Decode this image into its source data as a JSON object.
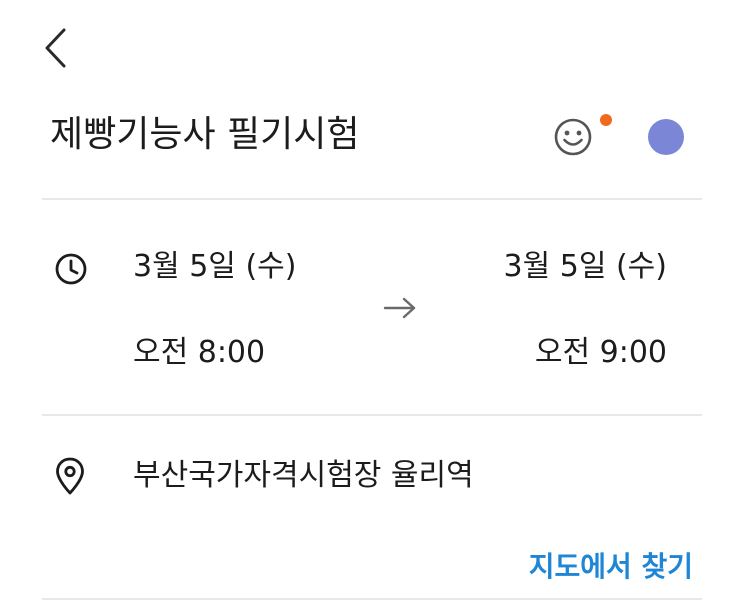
{
  "header": {
    "back_icon": "chevron-left-icon"
  },
  "event": {
    "title": "제빵기능사 필기시험",
    "sticker_icon": "smiley-icon",
    "sticker_badge_color": "#f06a1e",
    "calendar_color": "#7b87d6"
  },
  "time": {
    "icon": "clock-icon",
    "start_date": "3월 5일 (수)",
    "start_time": "오전 8:00",
    "end_date": "3월 5일 (수)",
    "end_time": "오전 9:00",
    "arrow_icon": "arrow-right-icon"
  },
  "location": {
    "icon": "map-pin-icon",
    "name": "부산국가자격시험장 율리역",
    "map_link_label": "지도에서 찾기",
    "link_color": "#1f86d6"
  },
  "colors": {
    "text": "#1c1c1c",
    "divider": "#e8e8e8",
    "background": "#ffffff"
  }
}
